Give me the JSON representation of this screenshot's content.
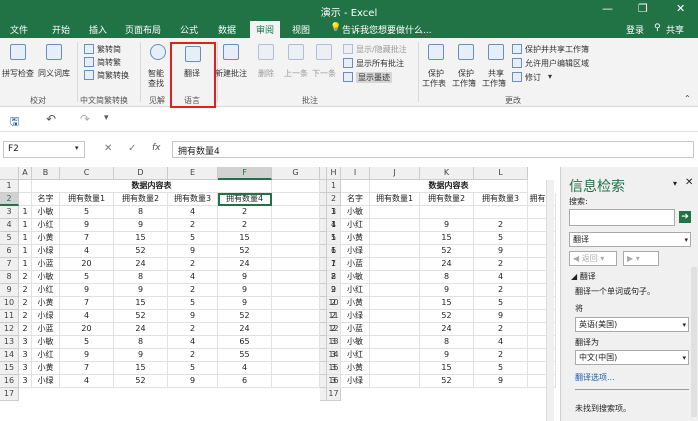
{
  "window": {
    "title": "演示 - Excel",
    "min": "—",
    "restore": "❐",
    "close": "✕"
  },
  "tabs": [
    "文件",
    "开始",
    "插入",
    "页面布局",
    "公式",
    "数据",
    "审阅",
    "视图"
  ],
  "tell_me": "告诉我您想要做什么...",
  "account": {
    "login": "登录",
    "share": "共享"
  },
  "ribbon": {
    "spell": "拼写检查",
    "thesaurus": "同义词库",
    "proofing": "校对",
    "to_trad": "繁转简",
    "to_simp": "简转繁",
    "conv": "简繁转换",
    "chinese_conv": "中文简繁转换",
    "smart_lookup_1": "智能",
    "smart_lookup_2": "查找",
    "insights": "见解",
    "translate": "翻译",
    "language": "语言",
    "new_comment": "新建批注",
    "delete": "删除",
    "prev": "上一条",
    "next": "下一条",
    "show_hide": "显示/隐藏批注",
    "show_all": "显示所有批注",
    "show_ink": "显示墨迹",
    "comments": "批注",
    "protect_sheet_1": "保护",
    "protect_sheet_2": "工作表",
    "protect_wb_1": "保护",
    "protect_wb_2": "工作簿",
    "share_wb_1": "共享",
    "share_wb_2": "工作簿",
    "protect_share": "保护并共享工作簿",
    "allow_edit": "允许用户编辑区域",
    "track": "修订",
    "changes": "更改"
  },
  "namebox": "F2",
  "formula": "拥有数量4",
  "title_cell": "数据内容表",
  "headers": [
    "名字",
    "拥有数量1",
    "拥有数量2",
    "拥有数量3",
    "拥有数量4"
  ],
  "right_headers": [
    "名字",
    "拥有数量1",
    "拥有数量2",
    "拥有数量3",
    "拥有数"
  ],
  "cols_left": [
    "A",
    "B",
    "C",
    "D",
    "E",
    "F",
    "G"
  ],
  "cols_right": [
    "H",
    "I",
    "J",
    "K",
    "L"
  ],
  "rows": [
    {
      "a": "1",
      "name": "小敏",
      "v": [
        "5",
        "8",
        "4",
        "2"
      ]
    },
    {
      "a": "1",
      "name": "小红",
      "v": [
        "9",
        "9",
        "2",
        "2"
      ]
    },
    {
      "a": "1",
      "name": "小黄",
      "v": [
        "7",
        "15",
        "5",
        "15"
      ]
    },
    {
      "a": "1",
      "name": "小绿",
      "v": [
        "4",
        "52",
        "9",
        "52"
      ]
    },
    {
      "a": "1",
      "name": "小蓝",
      "v": [
        "20",
        "24",
        "2",
        "24"
      ]
    },
    {
      "a": "2",
      "name": "小敏",
      "v": [
        "5",
        "8",
        "4",
        "9"
      ]
    },
    {
      "a": "2",
      "name": "小红",
      "v": [
        "9",
        "9",
        "2",
        "9"
      ]
    },
    {
      "a": "2",
      "name": "小黄",
      "v": [
        "7",
        "15",
        "5",
        "9"
      ]
    },
    {
      "a": "2",
      "name": "小绿",
      "v": [
        "4",
        "52",
        "9",
        "52"
      ]
    },
    {
      "a": "2",
      "name": "小蓝",
      "v": [
        "20",
        "24",
        "2",
        "24"
      ]
    },
    {
      "a": "3",
      "name": "小敏",
      "v": [
        "5",
        "8",
        "4",
        "65"
      ]
    },
    {
      "a": "3",
      "name": "小红",
      "v": [
        "9",
        "9",
        "2",
        "55"
      ]
    },
    {
      "a": "3",
      "name": "小黄",
      "v": [
        "7",
        "15",
        "5",
        "4"
      ]
    },
    {
      "a": "3",
      "name": "小绿",
      "v": [
        "4",
        "52",
        "9",
        "6"
      ]
    }
  ],
  "right_rows": [
    {
      "h": "1",
      "name": "小敏",
      "k": "",
      "l": ""
    },
    {
      "h": "1",
      "name": "小红",
      "k": "9",
      "l": "2"
    },
    {
      "h": "1",
      "name": "小黄",
      "k": "15",
      "l": "5"
    },
    {
      "h": "1",
      "name": "小绿",
      "k": "52",
      "l": "9"
    },
    {
      "h": "1",
      "name": "小蓝",
      "k": "24",
      "l": "2"
    },
    {
      "h": "2",
      "name": "小敏",
      "k": "8",
      "l": "4"
    },
    {
      "h": "2",
      "name": "小红",
      "k": "9",
      "l": "2"
    },
    {
      "h": "2",
      "name": "小黄",
      "k": "15",
      "l": "5"
    },
    {
      "h": "2",
      "name": "小绿",
      "k": "52",
      "l": "9"
    },
    {
      "h": "2",
      "name": "小蓝",
      "k": "24",
      "l": "2"
    },
    {
      "h": "3",
      "name": "小敏",
      "k": "8",
      "l": "4"
    },
    {
      "h": "3",
      "name": "小红",
      "k": "9",
      "l": "2"
    },
    {
      "h": "3",
      "name": "小黄",
      "k": "15",
      "l": "5"
    },
    {
      "h": "3",
      "name": "小绿",
      "k": "52",
      "l": "9"
    }
  ],
  "pane": {
    "title": "信息检索",
    "search_label": "搜索:",
    "service": "翻译",
    "back": "返回",
    "section": "翻译",
    "desc": "翻译一个单词或句子。",
    "from_label": "将",
    "from": "英语(美国)",
    "to_label": "翻译为",
    "to": "中文(中国)",
    "options": "翻译选项...",
    "no_results": "未找到搜索项。"
  }
}
